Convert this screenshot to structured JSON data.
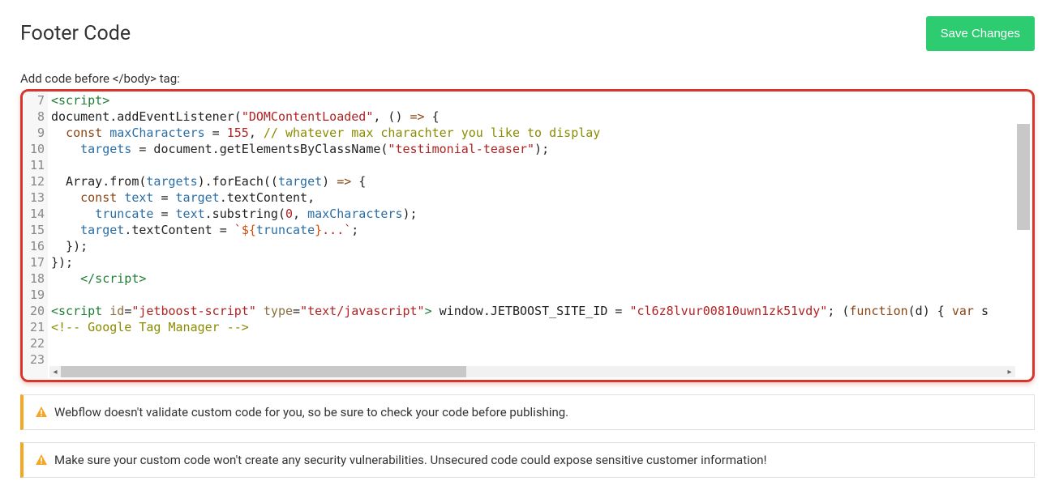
{
  "header": {
    "title": "Footer Code",
    "save_label": "Save Changes"
  },
  "label": "Add code before </body> tag:",
  "editor": {
    "first_line_no": 7,
    "line_numbers": [
      7,
      8,
      9,
      10,
      11,
      12,
      13,
      14,
      15,
      16,
      17,
      18,
      19,
      20,
      21,
      22,
      23
    ],
    "lines": [
      [
        {
          "cls": "tag",
          "t": "<script>"
        }
      ],
      [
        {
          "cls": "plain",
          "t": "document.addEventListener("
        },
        {
          "cls": "str",
          "t": "\"DOMContentLoaded\""
        },
        {
          "cls": "plain",
          "t": ", () "
        },
        {
          "cls": "kw",
          "t": "=>"
        },
        {
          "cls": "plain",
          "t": " {"
        }
      ],
      [
        {
          "cls": "plain",
          "t": "  "
        },
        {
          "cls": "kw",
          "t": "const"
        },
        {
          "cls": "plain",
          "t": " "
        },
        {
          "cls": "var",
          "t": "maxCharacters"
        },
        {
          "cls": "plain",
          "t": " = "
        },
        {
          "cls": "num",
          "t": "155"
        },
        {
          "cls": "plain",
          "t": ", "
        },
        {
          "cls": "cmt",
          "t": "// whatever max charachter you like to display"
        }
      ],
      [
        {
          "cls": "plain",
          "t": "    "
        },
        {
          "cls": "var",
          "t": "targets"
        },
        {
          "cls": "plain",
          "t": " = document.getElementsByClassName("
        },
        {
          "cls": "str",
          "t": "\"testimonial-teaser\""
        },
        {
          "cls": "plain",
          "t": ");"
        }
      ],
      [
        {
          "cls": "plain",
          "t": ""
        }
      ],
      [
        {
          "cls": "plain",
          "t": "  Array.from("
        },
        {
          "cls": "var",
          "t": "targets"
        },
        {
          "cls": "plain",
          "t": ").forEach(("
        },
        {
          "cls": "var",
          "t": "target"
        },
        {
          "cls": "plain",
          "t": ") "
        },
        {
          "cls": "kw",
          "t": "=>"
        },
        {
          "cls": "plain",
          "t": " {"
        }
      ],
      [
        {
          "cls": "plain",
          "t": "    "
        },
        {
          "cls": "kw",
          "t": "const"
        },
        {
          "cls": "plain",
          "t": " "
        },
        {
          "cls": "var",
          "t": "text"
        },
        {
          "cls": "plain",
          "t": " = "
        },
        {
          "cls": "var",
          "t": "target"
        },
        {
          "cls": "plain",
          "t": ".textContent,"
        }
      ],
      [
        {
          "cls": "plain",
          "t": "      "
        },
        {
          "cls": "var",
          "t": "truncate"
        },
        {
          "cls": "plain",
          "t": " = "
        },
        {
          "cls": "var",
          "t": "text"
        },
        {
          "cls": "plain",
          "t": ".substring("
        },
        {
          "cls": "num",
          "t": "0"
        },
        {
          "cls": "plain",
          "t": ", "
        },
        {
          "cls": "var",
          "t": "maxCharacters"
        },
        {
          "cls": "plain",
          "t": ");"
        }
      ],
      [
        {
          "cls": "plain",
          "t": "    "
        },
        {
          "cls": "var",
          "t": "target"
        },
        {
          "cls": "plain",
          "t": ".textContent = "
        },
        {
          "cls": "str",
          "t": "`"
        },
        {
          "cls": "tpl",
          "t": "${"
        },
        {
          "cls": "var",
          "t": "truncate"
        },
        {
          "cls": "tpl",
          "t": "}"
        },
        {
          "cls": "str",
          "t": "...`"
        },
        {
          "cls": "plain",
          "t": ";"
        }
      ],
      [
        {
          "cls": "plain",
          "t": "  });"
        }
      ],
      [
        {
          "cls": "plain",
          "t": "});"
        }
      ],
      [
        {
          "cls": "plain",
          "t": "    "
        },
        {
          "cls": "tag",
          "t": "</script>"
        }
      ],
      [
        {
          "cls": "plain",
          "t": ""
        }
      ],
      [
        {
          "cls": "tag",
          "t": "<script"
        },
        {
          "cls": "plain",
          "t": " "
        },
        {
          "cls": "attr",
          "t": "id"
        },
        {
          "cls": "plain",
          "t": "="
        },
        {
          "cls": "str",
          "t": "\"jetboost-script\""
        },
        {
          "cls": "plain",
          "t": " "
        },
        {
          "cls": "attr",
          "t": "type"
        },
        {
          "cls": "plain",
          "t": "="
        },
        {
          "cls": "str",
          "t": "\"text/javascript\""
        },
        {
          "cls": "tag",
          "t": ">"
        },
        {
          "cls": "plain",
          "t": " window.JETBOOST_SITE_ID = "
        },
        {
          "cls": "str",
          "t": "\"cl6z8lvur00810uwn1zk51vdy\""
        },
        {
          "cls": "plain",
          "t": "; ("
        },
        {
          "cls": "kw",
          "t": "function"
        },
        {
          "cls": "plain",
          "t": "(d) { "
        },
        {
          "cls": "kw",
          "t": "var"
        },
        {
          "cls": "plain",
          "t": " s"
        }
      ],
      [
        {
          "cls": "cmt",
          "t": "<!-- Google Tag Manager -->"
        }
      ],
      [
        {
          "cls": "plain",
          "t": ""
        }
      ],
      [
        {
          "cls": "plain",
          "t": ""
        }
      ]
    ]
  },
  "alerts": [
    "Webflow doesn't validate custom code for you, so be sure to check your code before publishing.",
    "Make sure your custom code won't create any security vulnerabilities. Unsecured code could expose sensitive customer information!"
  ]
}
